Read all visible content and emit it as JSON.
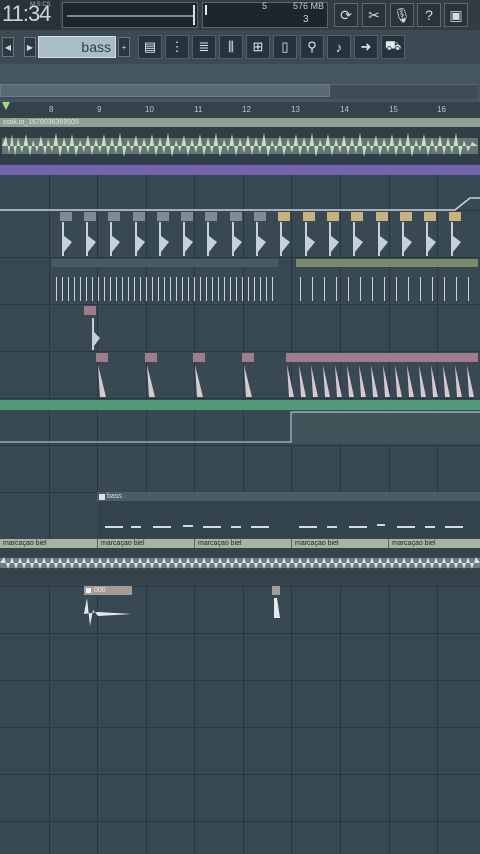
{
  "status": {
    "time_major": "11:34",
    "time_label": "M:S:CS",
    "pattern_number": "5",
    "ram": "576 MB",
    "polyphony": "3"
  },
  "toolbar": {
    "pattern_name": "bass",
    "icons": [
      "loop-icon",
      "scissors-icon",
      "microphone-icon",
      "help-icon",
      "save-icon",
      "playlist-icon",
      "step-seq-icon",
      "piano-roll-icon",
      "mixer-icon",
      "channel-rack-icon",
      "browser-icon",
      "plugin-icon",
      "tempo-icon",
      "export-icon",
      "cart-icon"
    ]
  },
  "ruler": {
    "ticks": [
      "8",
      "9",
      "10",
      "11",
      "12",
      "13",
      "14",
      "15",
      "16"
    ]
  },
  "clips": {
    "audio_track": "sstik.io_1678036369505",
    "bass_label": "bass",
    "marcacao": [
      "marcaçao biel",
      "marcaçao biel",
      "marcaçao biel",
      "marcaçao biel",
      "marcaçao biel"
    ],
    "sample_000": "000"
  },
  "colors": {
    "background": "#394954",
    "audio_clip": "#c8e0c3",
    "clip_header": "#a8b49f",
    "purple_bar": "#7563ad",
    "green_bar": "#4f9a7a",
    "pink_header": "#a07c8b"
  }
}
